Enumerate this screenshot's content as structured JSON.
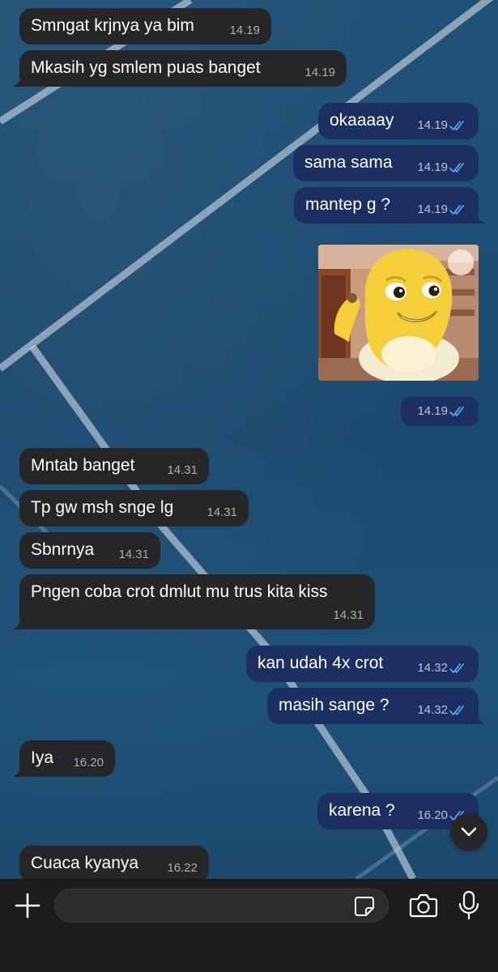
{
  "messages": [
    {
      "dir": "in",
      "text": "Smngat krjnya ya bim",
      "time": "14.19"
    },
    {
      "dir": "in",
      "text": "Mkasih yg smlem puas banget",
      "time": "14.19"
    },
    {
      "dir": "out",
      "text": "okaaaay",
      "time": "14.19"
    },
    {
      "dir": "out",
      "text": "sama sama",
      "time": "14.19"
    },
    {
      "dir": "out",
      "text": "mantep g ?",
      "time": "14.19"
    },
    {
      "dir": "out",
      "type": "sticker",
      "time": "14.19"
    },
    {
      "dir": "in",
      "text": "Mntab banget",
      "time": "14.31"
    },
    {
      "dir": "in",
      "text": "Tp gw msh snge lg",
      "time": "14.31"
    },
    {
      "dir": "in",
      "text": "Sbnrnya",
      "time": "14.31"
    },
    {
      "dir": "in",
      "text": "Pngen coba crot dmlut mu trus kita kiss",
      "time": "14.31"
    },
    {
      "dir": "out",
      "text": "kan udah 4x crot",
      "time": "14.32"
    },
    {
      "dir": "out",
      "text": "masih sange ?",
      "time": "14.32"
    },
    {
      "dir": "in",
      "text": "Iya",
      "time": "16.20"
    },
    {
      "dir": "out",
      "text": "karena ?",
      "time": "16.20"
    },
    {
      "dir": "in",
      "text": "Cuaca kyanya",
      "time": "16.22"
    }
  ],
  "colors": {
    "incoming_bubble": "#262628",
    "outgoing_bubble": "#1b2f60",
    "read_ticks": "#5aa4f5",
    "wallpaper": "#1c4c72"
  },
  "icons": {
    "attach": "plus-icon",
    "sticker": "sticker-icon",
    "camera": "camera-icon",
    "mic": "microphone-icon",
    "scroll": "chevron-down-icon"
  },
  "input": {
    "value": "",
    "placeholder": ""
  }
}
